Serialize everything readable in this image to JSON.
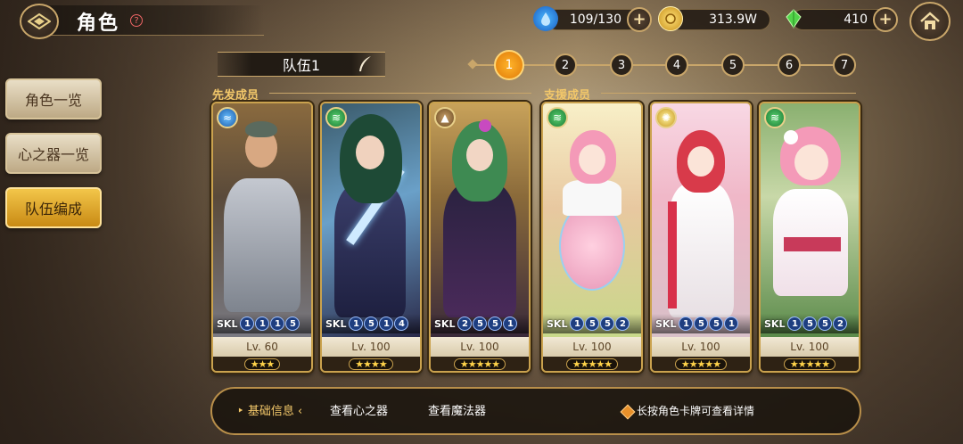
{
  "header": {
    "title": "角色",
    "help": "?"
  },
  "resources": {
    "stamina": {
      "value": "109/130",
      "icon": "water-drop-icon"
    },
    "gold": {
      "value": "313.9W",
      "icon": "gold-coin-icon"
    },
    "gems": {
      "value": "410",
      "icon": "green-crystal-icon"
    }
  },
  "sidebar": {
    "items": [
      {
        "label": "角色一览"
      },
      {
        "label": "心之器一览"
      },
      {
        "label": "队伍编成"
      }
    ]
  },
  "team": {
    "name": "队伍1"
  },
  "tabs": [
    "1",
    "2",
    "3",
    "4",
    "5",
    "6",
    "7"
  ],
  "sections": {
    "main": "先发成员",
    "support": "支援成员"
  },
  "cards": [
    {
      "element": "water",
      "skl": [
        "1",
        "1",
        "1",
        "5"
      ],
      "level": "Lv. 60",
      "stars": "★★★",
      "star_count": 3
    },
    {
      "element": "wind",
      "skl": [
        "1",
        "5",
        "1",
        "4"
      ],
      "level": "Lv. 100",
      "stars": "★★★★",
      "star_count": 4
    },
    {
      "element": "earth",
      "skl": [
        "2",
        "5",
        "5",
        "1"
      ],
      "level": "Lv. 100",
      "stars": "★★★★★",
      "star_count": 5
    },
    {
      "element": "wind",
      "skl": [
        "1",
        "5",
        "5",
        "2"
      ],
      "level": "Lv. 100",
      "stars": "★★★★★",
      "star_count": 5
    },
    {
      "element": "light",
      "skl": [
        "1",
        "5",
        "5",
        "1"
      ],
      "level": "Lv. 100",
      "stars": "★★★★★",
      "star_count": 5
    },
    {
      "element": "wind",
      "skl": [
        "1",
        "5",
        "5",
        "2"
      ],
      "level": "Lv. 100",
      "stars": "★★★★★",
      "star_count": 5
    }
  ],
  "skl_label": "SKL",
  "bottom": {
    "tabs": [
      "基础信息",
      "查看心之器",
      "查看魔法器"
    ],
    "tip": "长按角色卡牌可查看详情"
  },
  "colors": {
    "accent": "#c9a66a",
    "active_tab": "#f08c10",
    "active_side": "#e0a428"
  }
}
